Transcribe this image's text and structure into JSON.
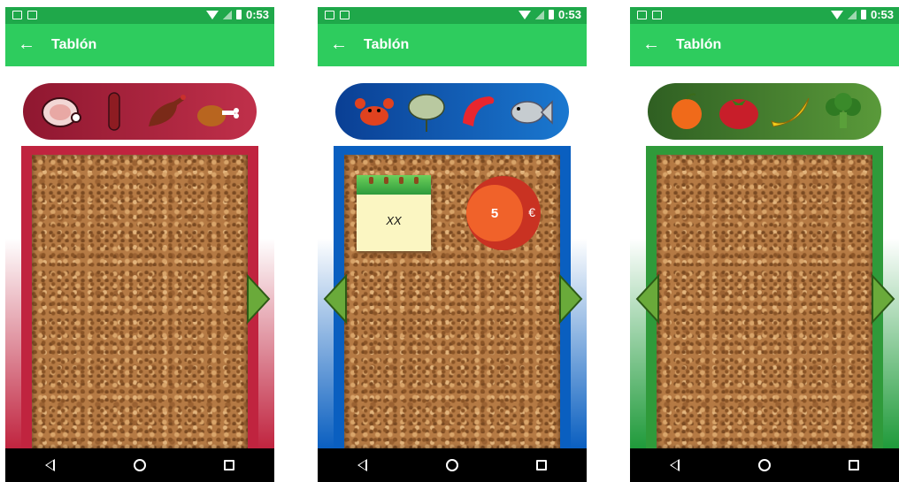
{
  "status": {
    "time": "0:53"
  },
  "appbar": {
    "title": "Tablón",
    "back_icon": "arrow-left-icon"
  },
  "boards": [
    {
      "category": "meat",
      "pill_color": "#a51f3c",
      "frame_color": "#c0243f",
      "icons": [
        "ham-icon",
        "sausage-icon",
        "leg-ham-icon",
        "drumstick-icon"
      ]
    },
    {
      "category": "seafood",
      "pill_color": "#0d4fa8",
      "frame_color": "#0a5fc0",
      "icons": [
        "crab-icon",
        "ray-icon",
        "shrimp-icon",
        "fish-icon"
      ]
    },
    {
      "category": "produce",
      "pill_color": "#3d7a2a",
      "frame_color": "#2f9a3a",
      "icons": [
        "orange-icon",
        "tomato-icon",
        "banana-icon",
        "broccoli-icon"
      ]
    }
  ],
  "note": {
    "text": "XX"
  },
  "price": {
    "value": "5",
    "currency": "€"
  },
  "colors": {
    "statusbar": "#1fa84a",
    "appbar": "#2ecc5e",
    "arrow": "#6aaa3a"
  }
}
